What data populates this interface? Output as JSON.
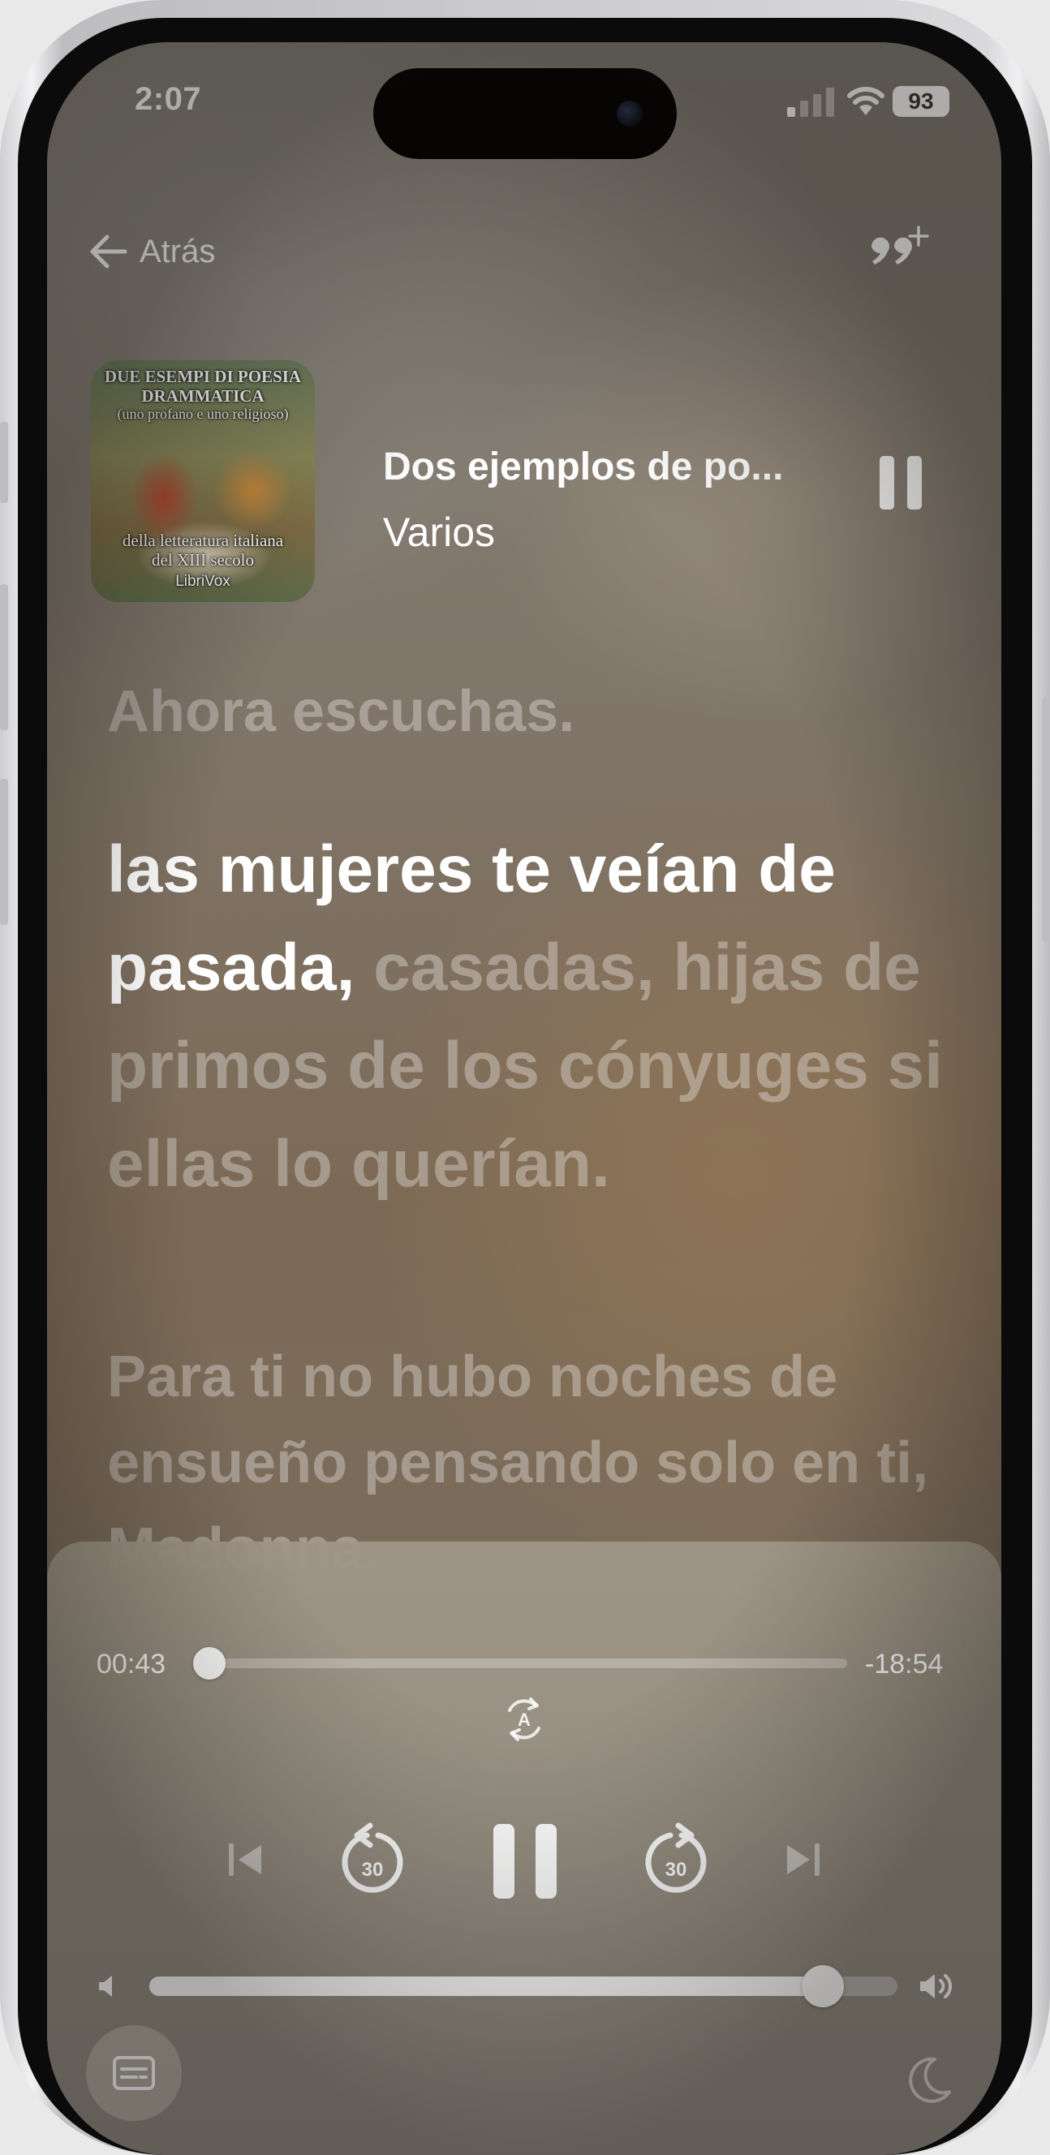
{
  "status_bar": {
    "time": "2:07",
    "battery": "93"
  },
  "header": {
    "back_label": "Atrás"
  },
  "now_playing": {
    "cover_lines": [
      "DUE ESEMPI DI POESIA",
      "DRAMMATICA",
      "(uno profano e uno religioso)",
      "della letteratura italiana",
      "del XIII secolo",
      "LibriVox"
    ],
    "title": "Dos ejemplos de po...",
    "author": "Varios"
  },
  "lyrics": {
    "now_listening": "Ahora escuchas.",
    "active": "las mujeres te veían de pasada,",
    "remaining": " casadas, hijas de primos de los cónyuges si ellas lo querían.",
    "next": "Para ti no hubo noches de ensueño pensando solo en ti, Madonna."
  },
  "player": {
    "elapsed": "00:43",
    "remaining": "-18:54",
    "progress_fraction": 0.018,
    "volume_fraction": 0.9,
    "skip_back_seconds": "30",
    "skip_forward_seconds": "30",
    "auto_badge": "A"
  },
  "colors": {
    "accent": "#ffffff",
    "dim_text": "rgba(255,255,255,0.32)"
  }
}
